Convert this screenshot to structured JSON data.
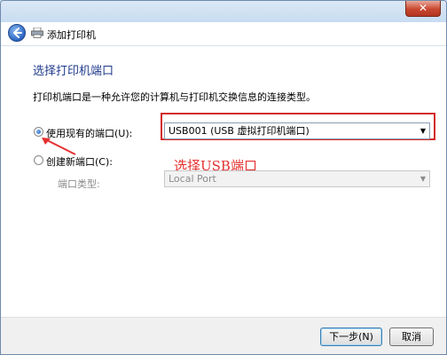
{
  "window": {
    "close_glyph": "✕"
  },
  "header": {
    "title": "添加打印机",
    "back_icon": "back-arrow-icon",
    "printer_icon": "printer-icon"
  },
  "page": {
    "heading": "选择打印机端口",
    "description": "打印机端口是一种允许您的计算机与打印机交换信息的连接类型。"
  },
  "options": {
    "existing_label": "使用现有的端口(U):",
    "existing_selected": true,
    "existing_value": "USB001 (USB 虚拟打印机端口)",
    "new_label": "创建新端口(C):",
    "new_selected": false,
    "port_type_label": "端口类型:",
    "port_type_value": "Local Port"
  },
  "annotation": {
    "text": "选择USB端口",
    "color": "#e5302f"
  },
  "footer": {
    "next_label": "下一步(N)",
    "cancel_label": "取消"
  },
  "colors": {
    "accent": "#1f3a8c",
    "highlight": "#d4292a"
  }
}
